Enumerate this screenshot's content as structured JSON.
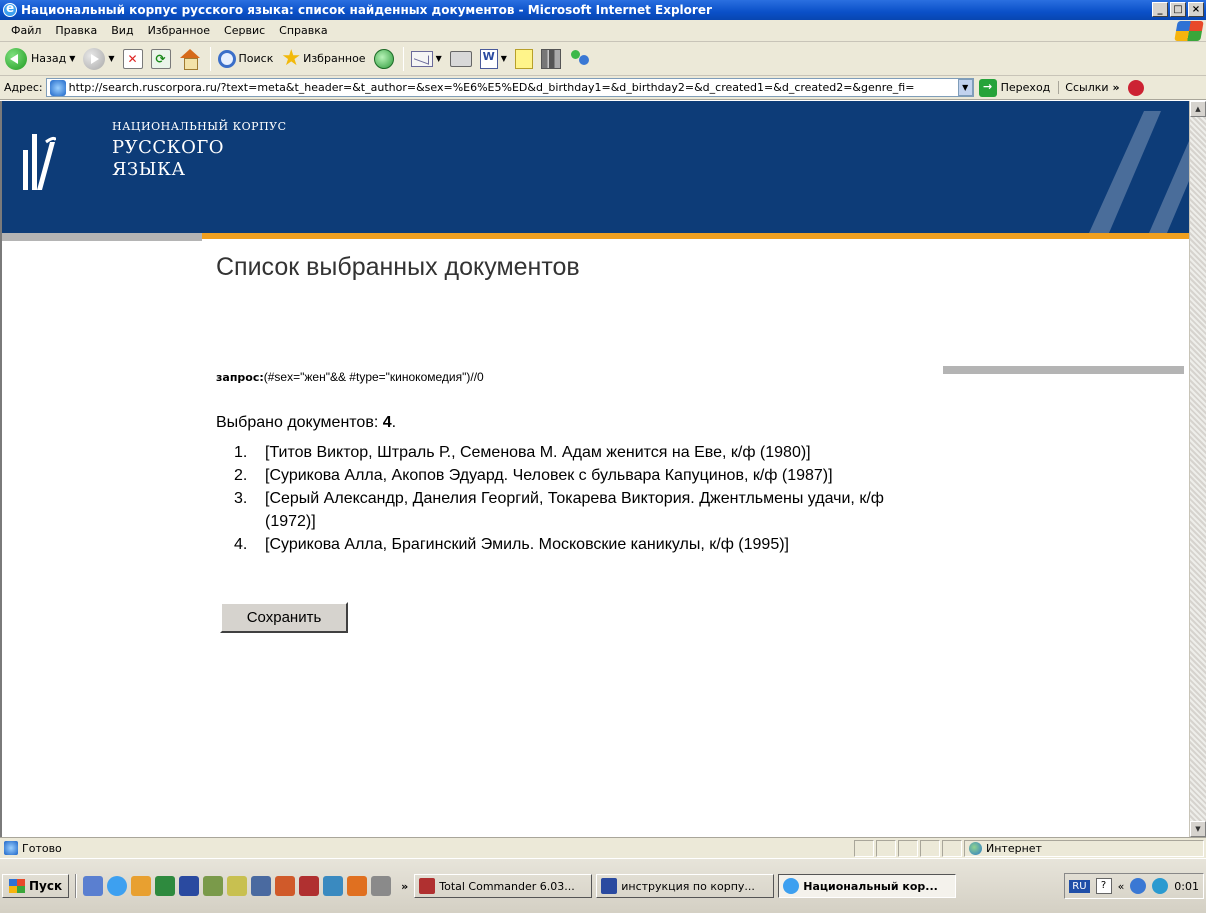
{
  "window": {
    "title": "Национальный корпус русского языка: список найденных документов - Microsoft Internet Explorer",
    "min": "_",
    "max": "□",
    "close": "×"
  },
  "menu": [
    "Файл",
    "Правка",
    "Вид",
    "Избранное",
    "Сервис",
    "Справка"
  ],
  "toolbar": {
    "back": "Назад",
    "search": "Поиск",
    "favorites": "Избранное"
  },
  "address": {
    "label": "Адрес:",
    "url": "http://search.ruscorpora.ru/?text=meta&t_header=&t_author=&sex=%E6%E5%ED&d_birthday1=&d_birthday2=&d_created1=&d_created2=&genre_fi=",
    "go": "Переход",
    "links": "Ссылки"
  },
  "site": {
    "logo_line1": "НАЦИОНАЛЬНЫЙ КОРПУС",
    "logo_line2": "РУССКОГО",
    "logo_line3": "ЯЗЫКА"
  },
  "page": {
    "title": "Список выбранных документов",
    "query_label": "запрос:",
    "query_value": "(#sex=\"жен\"&& #type=\"кинокомедия\")//0",
    "selected_label": "Выбрано документов: ",
    "selected_count": "4",
    "selected_dot": ".",
    "documents": [
      {
        "num": "1.",
        "text": "[Титов Виктор, Штраль Р., Семенова М. Адам женится на Еве, к/ф (1980)]"
      },
      {
        "num": "2.",
        "text": "[Сурикова Алла, Акопов Эдуард. Человек с бульвара Капуцинов, к/ф (1987)]"
      },
      {
        "num": "3.",
        "text": "[Серый Александр, Данелия Георгий, Токарева Виктория. Джентльмены удачи, к/ф (1972)]"
      },
      {
        "num": "4.",
        "text": "[Сурикова Алла, Брагинский Эмиль. Московские каникулы, к/ф (1995)]"
      }
    ],
    "save": "Сохранить"
  },
  "status": {
    "text": "Готово",
    "zone": "Интернет"
  },
  "taskbar": {
    "start": "Пуск",
    "more": "»",
    "tasks": [
      {
        "label": "Total Commander 6.03...",
        "active": false
      },
      {
        "label": "инструкция по корпу...",
        "active": false
      },
      {
        "label": "Национальный кор...",
        "active": true
      }
    ],
    "lang": "RU",
    "tray_chev": "«",
    "clock": "0:01"
  }
}
